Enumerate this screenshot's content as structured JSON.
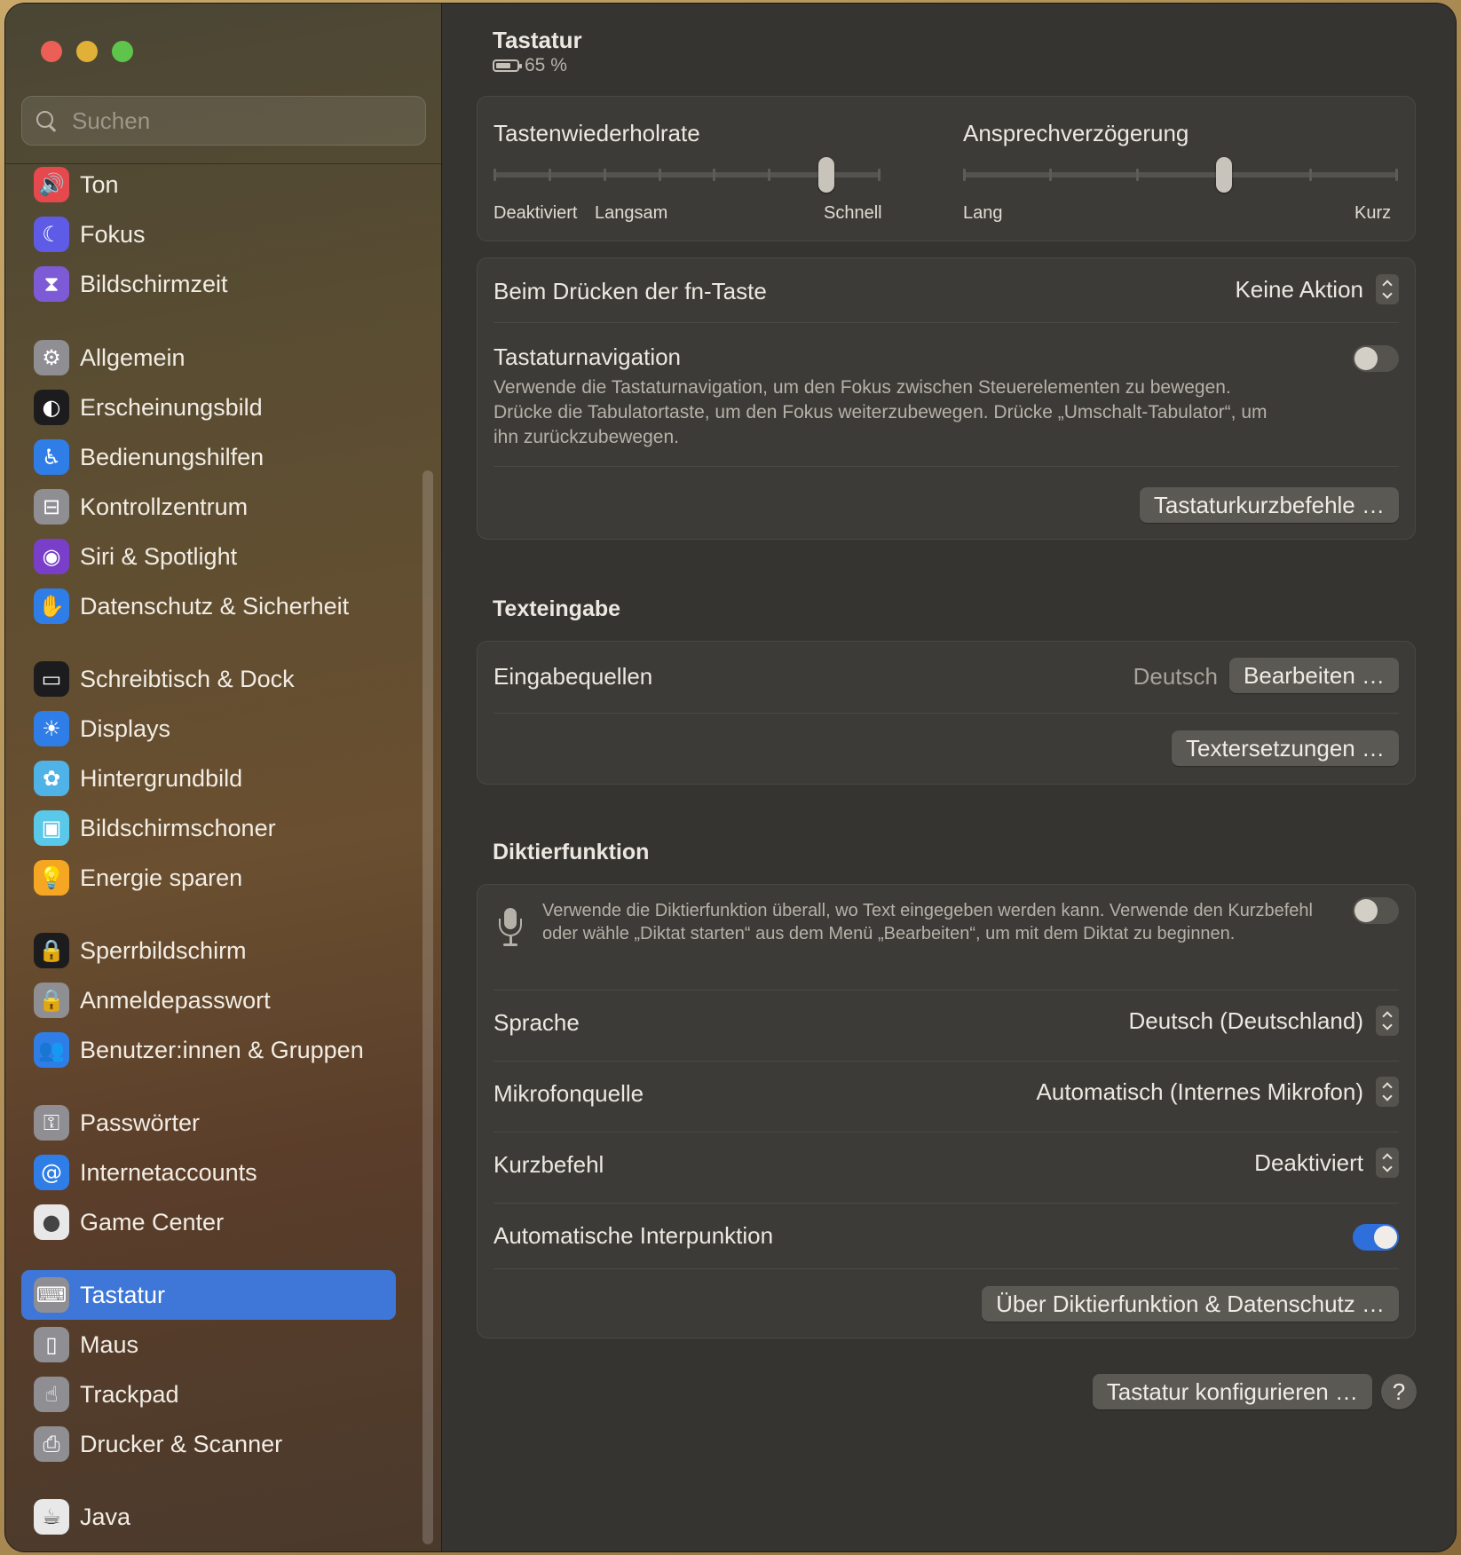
{
  "sidebar": {
    "search_placeholder": "Suchen",
    "items": [
      {
        "label": "Ton",
        "icon": "speaker-icon",
        "color": "#e5484d"
      },
      {
        "label": "Fokus",
        "icon": "moon-icon",
        "color": "#5e5ce6"
      },
      {
        "label": "Bildschirmzeit",
        "icon": "hourglass-icon",
        "color": "#7e5bd6"
      },
      {
        "label": "Allgemein",
        "icon": "gear-icon",
        "color": "#8e8e93"
      },
      {
        "label": "Erscheinungsbild",
        "icon": "appearance-icon",
        "color": "#1c1c1e"
      },
      {
        "label": "Bedienungshilfen",
        "icon": "accessibility-icon",
        "color": "#2f7ee8"
      },
      {
        "label": "Kontrollzentrum",
        "icon": "switches-icon",
        "color": "#8e8e93"
      },
      {
        "label": "Siri & Spotlight",
        "icon": "siri-icon",
        "color": "#7a3fc9"
      },
      {
        "label": "Datenschutz & Sicherheit",
        "icon": "hand-icon",
        "color": "#2f7ee8"
      },
      {
        "label": "Schreibtisch & Dock",
        "icon": "dock-icon",
        "color": "#1c1c1e"
      },
      {
        "label": "Displays",
        "icon": "sun-icon",
        "color": "#2f7ee8"
      },
      {
        "label": "Hintergrundbild",
        "icon": "flower-icon",
        "color": "#4fb3e8"
      },
      {
        "label": "Bildschirmschoner",
        "icon": "screensaver-icon",
        "color": "#5ac8e8"
      },
      {
        "label": "Energie sparen",
        "icon": "bulb-icon",
        "color": "#f5a623"
      },
      {
        "label": "Sperrbildschirm",
        "icon": "lockscreen-icon",
        "color": "#1c1c1e"
      },
      {
        "label": "Anmeldepasswort",
        "icon": "lock-icon",
        "color": "#8e8e93"
      },
      {
        "label": "Benutzer:innen & Gruppen",
        "icon": "users-icon",
        "color": "#2f7ee8"
      },
      {
        "label": "Passwörter",
        "icon": "key-icon",
        "color": "#8e8e93"
      },
      {
        "label": "Internetaccounts",
        "icon": "at-icon",
        "color": "#2f7ee8"
      },
      {
        "label": "Game Center",
        "icon": "gamecenter-icon",
        "color": "#e8e8e8"
      },
      {
        "label": "Tastatur",
        "icon": "keyboard-icon",
        "color": "#8e8e93",
        "active": true
      },
      {
        "label": "Maus",
        "icon": "mouse-icon",
        "color": "#8e8e93"
      },
      {
        "label": "Trackpad",
        "icon": "trackpad-icon",
        "color": "#8e8e93"
      },
      {
        "label": "Drucker & Scanner",
        "icon": "printer-icon",
        "color": "#8e8e93"
      },
      {
        "label": "Java",
        "icon": "java-icon",
        "color": "#e8e8e8"
      }
    ]
  },
  "header": {
    "title": "Tastatur",
    "battery": "65 %"
  },
  "repeat": {
    "rate_label": "Tastenwiederholrate",
    "rate_value": 0.86,
    "rate_scale_left": "Deaktiviert",
    "rate_scale_mid": "Langsam",
    "rate_scale_right": "Schnell",
    "delay_label": "Ansprechverzögerung",
    "delay_value": 0.6,
    "delay_scale_left": "Lang",
    "delay_scale_right": "Kurz"
  },
  "fn": {
    "label": "Beim Drücken der fn-Taste",
    "value": "Keine Aktion"
  },
  "nav": {
    "label": "Tastaturnavigation",
    "description": "Verwende die Tastaturnavigation, um den Fokus zwischen Steuerelementen zu bewegen. Drücke die Tabulatortaste, um den Fokus weiterzubewegen. Drücke „Umschalt-Tabulator“, um ihn zurückzubewegen.",
    "enabled": false,
    "shortcuts_button": "Tastaturkurzbefehle …"
  },
  "text_input": {
    "heading": "Texteingabe",
    "sources_label": "Eingabequellen",
    "sources_value": "Deutsch",
    "edit_button": "Bearbeiten …",
    "replacements_button": "Textersetzungen …"
  },
  "dictation": {
    "heading": "Diktierfunktion",
    "description": "Verwende die Diktierfunktion überall, wo Text eingegeben werden kann. Verwende den Kurzbefehl oder wähle „Diktat starten“ aus dem Menü „Bearbeiten“, um mit dem Diktat zu beginnen.",
    "enabled": false,
    "language_label": "Sprache",
    "language_value": "Deutsch (Deutschland)",
    "mic_label": "Mikrofonquelle",
    "mic_value": "Automatisch (Internes Mikrofon)",
    "shortcut_label": "Kurzbefehl",
    "shortcut_value": "Deaktiviert",
    "punct_label": "Automatische Interpunktion",
    "punct_enabled": true,
    "privacy_button": "Über Diktierfunktion & Datenschutz …"
  },
  "footer": {
    "configure_button": "Tastatur konfigurieren …",
    "help": "?"
  }
}
